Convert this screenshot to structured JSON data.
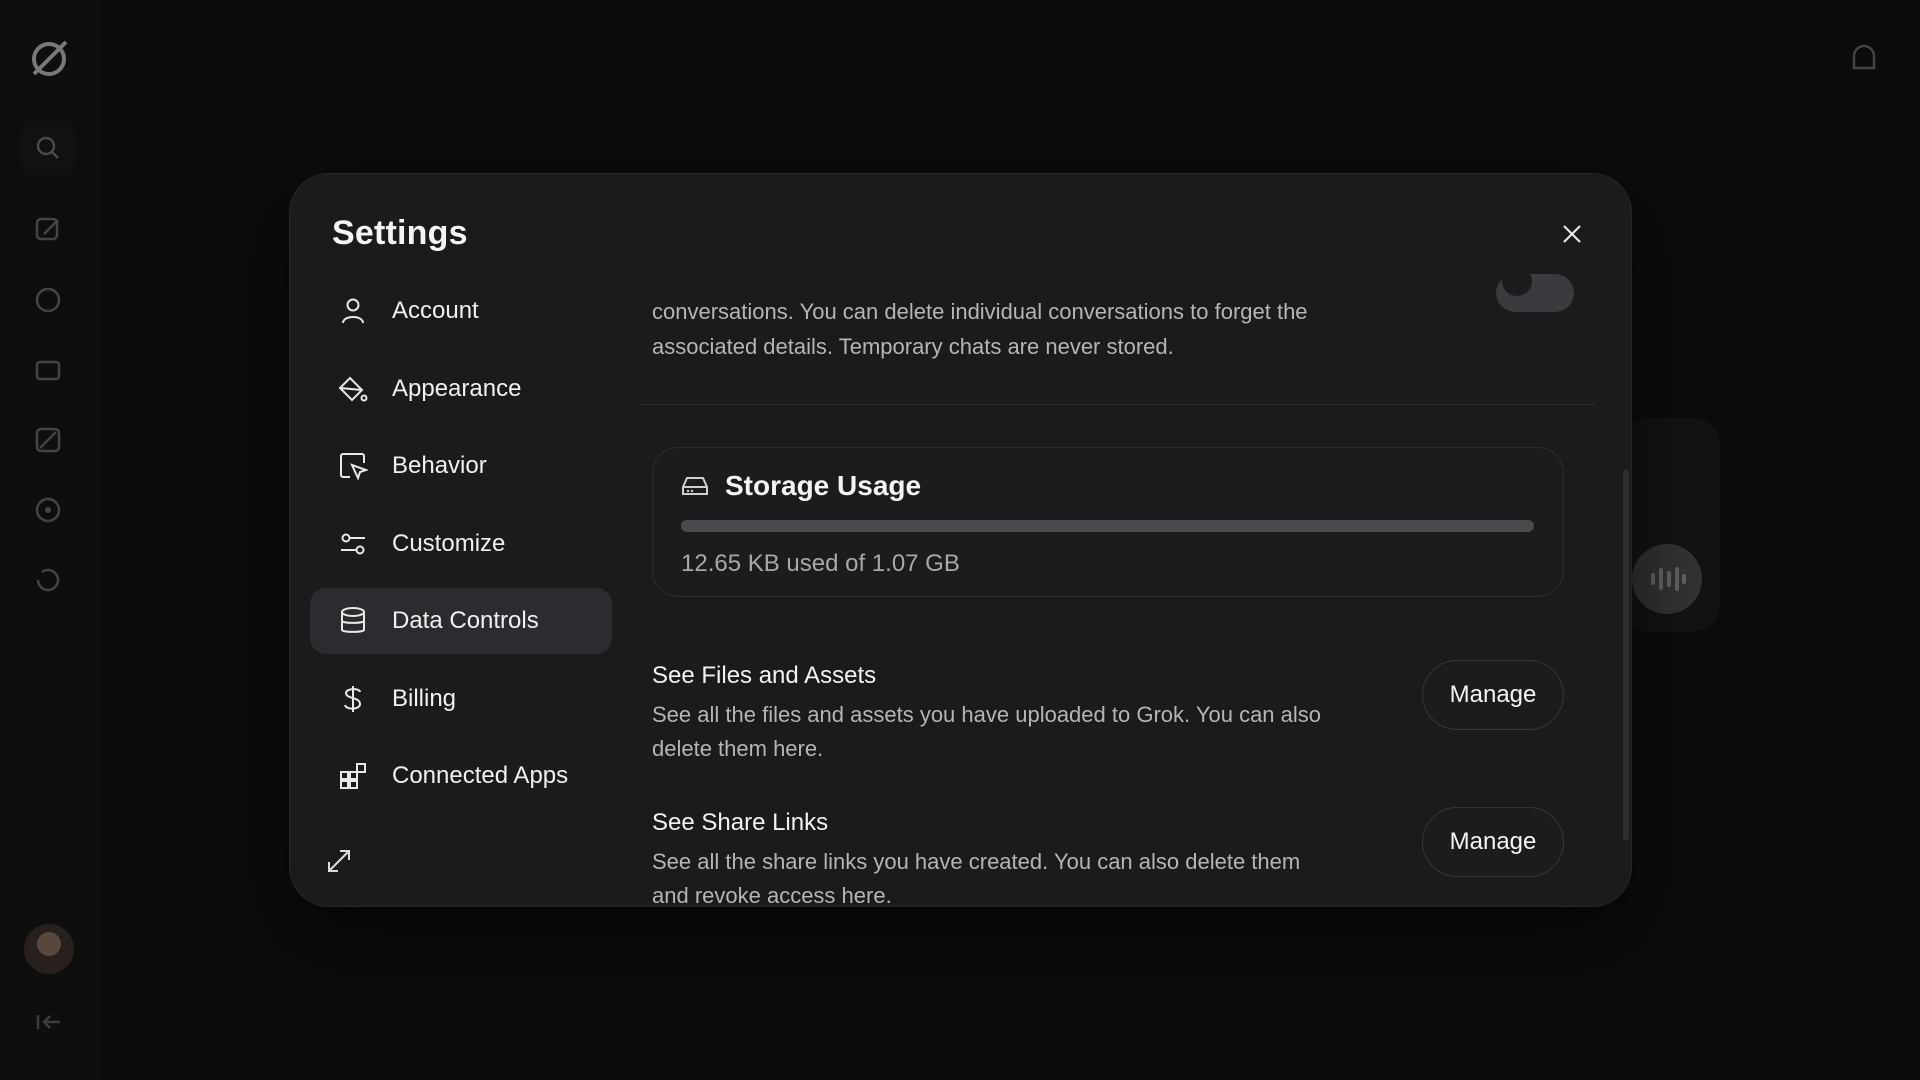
{
  "modal": {
    "title": "Settings",
    "close_icon": "close-icon"
  },
  "nav": {
    "items": [
      {
        "label": "Account",
        "icon": "user-icon"
      },
      {
        "label": "Appearance",
        "icon": "paint-bucket-icon"
      },
      {
        "label": "Behavior",
        "icon": "cursor-click-icon"
      },
      {
        "label": "Customize",
        "icon": "sliders-icon"
      },
      {
        "label": "Data Controls",
        "icon": "database-icon",
        "active": true
      },
      {
        "label": "Billing",
        "icon": "dollar-icon"
      },
      {
        "label": "Connected Apps",
        "icon": "apps-icon"
      }
    ],
    "expand_icon": "expand-icon"
  },
  "content": {
    "fragment_text": "conversations. You can delete individual conversations to forget the associated details. Temporary chats are never stored.",
    "storage": {
      "title": "Storage Usage",
      "icon": "hard-drive-icon",
      "usage_text": "12.65 KB used of 1.07 GB",
      "used_fraction": 0.0
    },
    "rows": [
      {
        "title": "See Files and Assets",
        "description": "See all the files and assets you have uploaded to Grok. You can also delete them here.",
        "button": "Manage"
      },
      {
        "title": "See Share Links",
        "description": "See all the share links you have created. You can also delete them and revoke access here.",
        "button": "Manage"
      }
    ]
  },
  "colors": {
    "background": "#0c0c0d",
    "modal": "#1a1b1d",
    "active_nav": "#2b2c2f",
    "text_primary": "#f2f2f2",
    "text_secondary": "#b4b5b8"
  }
}
